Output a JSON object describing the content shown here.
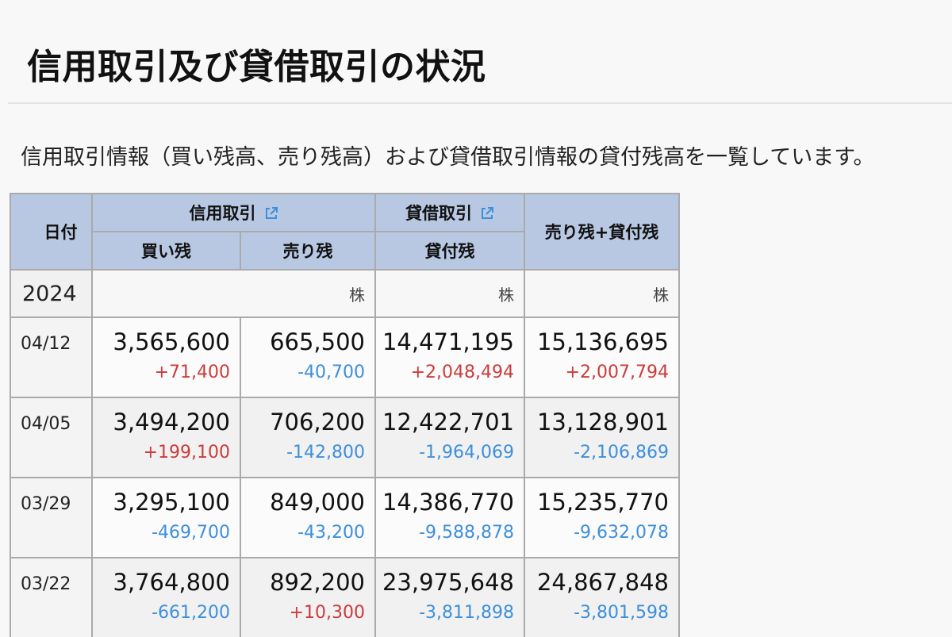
{
  "page": {
    "title": "信用取引及び貸借取引の状況",
    "description": "信用取引情報（買い残高、売り残高）および貸借取引情報の貸付残高を一覧しています。"
  },
  "table": {
    "headers": {
      "date": "日付",
      "margin_trading": "信用取引",
      "lending_trading": "貸借取引",
      "short_plus_lending": "売り残+貸付残",
      "buy_balance": "買い残",
      "sell_balance": "売り残",
      "lending_balance": "貸付残"
    },
    "year": "2024",
    "unit": "株",
    "rows": [
      {
        "date": "04/12",
        "buy": "3,565,600",
        "buy_diff": "+71,400",
        "sell": "665,500",
        "sell_diff": "-40,700",
        "lend": "14,471,195",
        "lend_diff": "+2,048,494",
        "total": "15,136,695",
        "total_diff": "+2,007,794"
      },
      {
        "date": "04/05",
        "buy": "3,494,200",
        "buy_diff": "+199,100",
        "sell": "706,200",
        "sell_diff": "-142,800",
        "lend": "12,422,701",
        "lend_diff": "-1,964,069",
        "total": "13,128,901",
        "total_diff": "-2,106,869"
      },
      {
        "date": "03/29",
        "buy": "3,295,100",
        "buy_diff": "-469,700",
        "sell": "849,000",
        "sell_diff": "-43,200",
        "lend": "14,386,770",
        "lend_diff": "-9,588,878",
        "total": "15,235,770",
        "total_diff": "-9,632,078"
      },
      {
        "date": "03/22",
        "buy": "3,764,800",
        "buy_diff": "-661,200",
        "sell": "892,200",
        "sell_diff": "+10,300",
        "lend": "23,975,648",
        "lend_diff": "-3,811,898",
        "total": "24,867,848",
        "total_diff": "-3,801,598"
      }
    ]
  },
  "colors": {
    "header_bg": "#b8c8e2",
    "positive": "#cc3b3b",
    "negative": "#3d8fdc",
    "link_icon": "#3d8fdc"
  },
  "icons": {
    "external_link": "external-link-icon"
  }
}
